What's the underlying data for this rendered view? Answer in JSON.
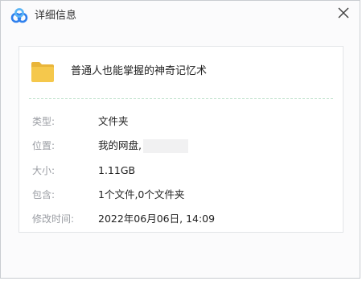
{
  "window": {
    "title": "详细信息",
    "close_icon": "close-icon",
    "logo_icon": "baidu-netdisk-logo",
    "colors": {
      "logo_blue": "#2f80ed",
      "logo_light_blue": "#5ab4f5",
      "folder_yellow": "#f5c84c",
      "divider": "#c3e4cf",
      "label_gray": "#9a9da3",
      "text": "#222222"
    }
  },
  "file": {
    "icon": "folder-icon",
    "name": "普通人也能掌握的神奇记忆术"
  },
  "details": {
    "type_label": "类型:",
    "type_value": "文件夹",
    "location_label": "位置:",
    "location_value": "我的网盘,",
    "size_label": "大小:",
    "size_value": "1.11GB",
    "contains_label": "包含:",
    "contains_value": "1个文件,0个文件夹",
    "modified_label": "修改时间:",
    "modified_value": "2022年06月06日, 14:09"
  }
}
